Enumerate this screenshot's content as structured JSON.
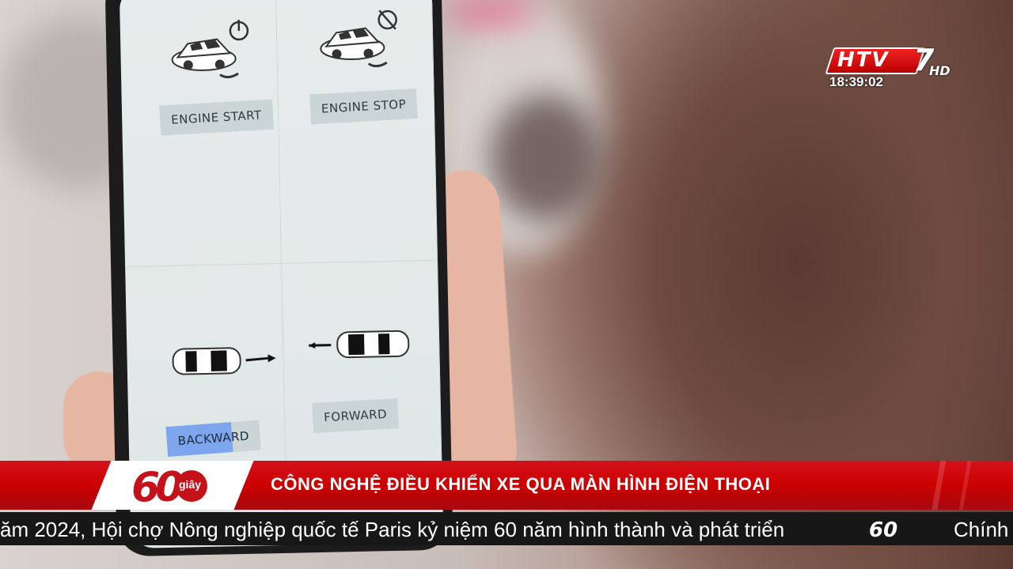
{
  "broadcast": {
    "channel_logo": "HTV",
    "channel_number": "7",
    "channel_hd": "HD",
    "time": "18:39:02"
  },
  "app_screen": {
    "buttons": [
      {
        "label": "ENGINE START",
        "icon": "car-power-icon"
      },
      {
        "label": "ENGINE STOP",
        "icon": "car-power-off-icon"
      },
      {
        "label": "BACKWARD",
        "icon": "car-backward-icon",
        "active": true
      },
      {
        "label": "FORWARD",
        "icon": "car-forward-icon",
        "active": false
      }
    ]
  },
  "program": {
    "badge_number": "60",
    "badge_sub": "giây",
    "headline": "CÔNG NGHỆ ĐIỀU KHIỂN XE QUA MÀN HÌNH ĐIỆN THOẠI"
  },
  "ticker": {
    "text": "ăm 2024, Hội chợ Nông nghiệp quốc tế Paris kỷ niệm 60 năm hình thành và phát triển",
    "logo": "60",
    "right_text": "Chính"
  },
  "colors": {
    "headline_red": "#c5121a",
    "ticker_bg": "#171717",
    "active_button": "#7ea6ee"
  }
}
